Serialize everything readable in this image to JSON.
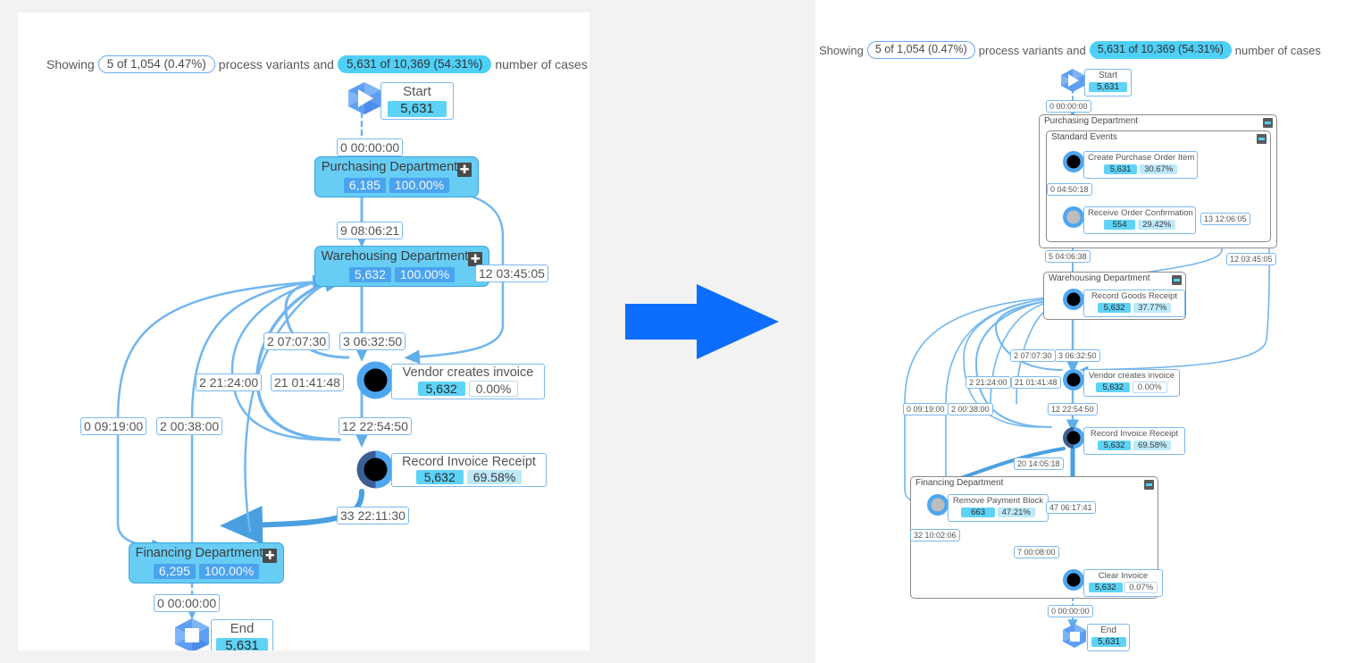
{
  "theme": {
    "accent": "#0d6efd",
    "node_cyan": "#5ed3f7",
    "dept_fill": "#67cdf5",
    "edge_blue": "#71b6ef",
    "edge_dark": "#4a9fe0",
    "ring_dark": "#3b5f93",
    "page_bg": "#f2f2f2",
    "panel_bg": "#ffffff"
  },
  "header": {
    "showing_label": "Showing",
    "variants_pill": "5 of 1,054 (0.47%)",
    "mid_label": "process variants and",
    "cases_pill": "5,631 of 10,369 (54.31%)",
    "tail_label": "number of cases"
  },
  "center_arrow": {
    "icon": "arrow-right-icon",
    "color": "#0d6efd"
  },
  "left_panel": {
    "name": "collapsed-process-map",
    "nodes": [
      {
        "id": "start",
        "type": "start-event",
        "label": "Start",
        "count": "5,631"
      },
      {
        "id": "purchasing",
        "type": "department-group",
        "label": "Purchasing Department",
        "count": "6,185",
        "percent": "100.00%",
        "toggle": "expand-icon"
      },
      {
        "id": "warehousing",
        "type": "department-group",
        "label": "Warehousing Department",
        "count": "5,632",
        "percent": "100.00%",
        "toggle": "expand-icon"
      },
      {
        "id": "vendor-invoice",
        "type": "activity",
        "label": "Vendor creates invoice",
        "count": "5,632",
        "percent": "0.00%"
      },
      {
        "id": "record-invoice",
        "type": "activity",
        "label": "Record Invoice Receipt",
        "count": "5,632",
        "percent": "69.58%"
      },
      {
        "id": "financing",
        "type": "department-group",
        "label": "Financing Department",
        "count": "6,295",
        "percent": "100.00%",
        "toggle": "expand-icon"
      },
      {
        "id": "end",
        "type": "end-event",
        "label": "End",
        "count": "5,631"
      }
    ],
    "edge_labels": [
      {
        "id": "e1",
        "text": "0 00:00:00"
      },
      {
        "id": "e2",
        "text": "9 08:06:21"
      },
      {
        "id": "e3",
        "text": "12 03:45:05"
      },
      {
        "id": "e4",
        "text": "2 07:07:30"
      },
      {
        "id": "e5",
        "text": "3 06:32:50"
      },
      {
        "id": "e6",
        "text": "2 21:24:00"
      },
      {
        "id": "e7",
        "text": "21 01:41:48"
      },
      {
        "id": "e8",
        "text": "12 22:54:50"
      },
      {
        "id": "e9",
        "text": "0 09:19:00"
      },
      {
        "id": "e10",
        "text": "2 00:38:00"
      },
      {
        "id": "e11",
        "text": "33 22:11:30"
      },
      {
        "id": "e12",
        "text": "0 00:00:00"
      }
    ]
  },
  "right_panel": {
    "name": "expanded-process-map",
    "groups": [
      {
        "id": "purchasing-group",
        "label": "Purchasing Department",
        "toggle": "collapse-icon"
      },
      {
        "id": "standard-events-group",
        "label": "Standard Events",
        "toggle": "collapse-icon"
      },
      {
        "id": "warehousing-group",
        "label": "Warehousing Department",
        "toggle": "collapse-icon"
      },
      {
        "id": "financing-group",
        "label": "Financing Department",
        "toggle": "collapse-icon"
      }
    ],
    "nodes": [
      {
        "id": "start",
        "type": "start-event",
        "label": "Start",
        "count": "5,631"
      },
      {
        "id": "create-po-item",
        "type": "activity",
        "label": "Create Purchase Order Item",
        "count": "5,631",
        "percent": "30.67%"
      },
      {
        "id": "receive-order-confirmation",
        "type": "activity-gray",
        "label": "Receive Order Confirmation",
        "count": "554",
        "percent": "29.42%"
      },
      {
        "id": "record-goods-receipt",
        "type": "activity",
        "label": "Record Goods Receipt",
        "count": "5,632",
        "percent": "37.77%"
      },
      {
        "id": "vendor-invoice",
        "type": "activity",
        "label": "Vendor creates invoice",
        "count": "5,632",
        "percent": "0.00%"
      },
      {
        "id": "record-invoice",
        "type": "activity",
        "label": "Record Invoice Receipt",
        "count": "5,632",
        "percent": "69.58%"
      },
      {
        "id": "remove-payment-block",
        "type": "activity-gray",
        "label": "Remove Payment Block",
        "count": "663",
        "percent": "47.21%"
      },
      {
        "id": "clear-invoice",
        "type": "activity",
        "label": "Clear Invoice",
        "count": "5,632",
        "percent": "0.07%"
      },
      {
        "id": "end",
        "type": "end-event",
        "label": "End",
        "count": "5,631"
      }
    ],
    "edge_labels": [
      {
        "id": "r1",
        "text": "0 00:00:00"
      },
      {
        "id": "r2",
        "text": "0 04:50:18"
      },
      {
        "id": "r3",
        "text": "13 12:06:05"
      },
      {
        "id": "r4",
        "text": "5 04:06:38"
      },
      {
        "id": "r5",
        "text": "12 03:45:05"
      },
      {
        "id": "r6",
        "text": "2 07:07:30"
      },
      {
        "id": "r7",
        "text": "3 06:32:50"
      },
      {
        "id": "r8",
        "text": "2 21:24:00"
      },
      {
        "id": "r9",
        "text": "21 01:41:48"
      },
      {
        "id": "r10",
        "text": "0 09:19:00"
      },
      {
        "id": "r11",
        "text": "2 00:38:00"
      },
      {
        "id": "r12",
        "text": "12 22:54:50"
      },
      {
        "id": "r13",
        "text": "20 14:05:18"
      },
      {
        "id": "r14",
        "text": "47 06:17:41"
      },
      {
        "id": "r15",
        "text": "32 10:02:06"
      },
      {
        "id": "r16",
        "text": "7 00:08:00"
      },
      {
        "id": "r17",
        "text": "0 00:00:00"
      }
    ]
  }
}
